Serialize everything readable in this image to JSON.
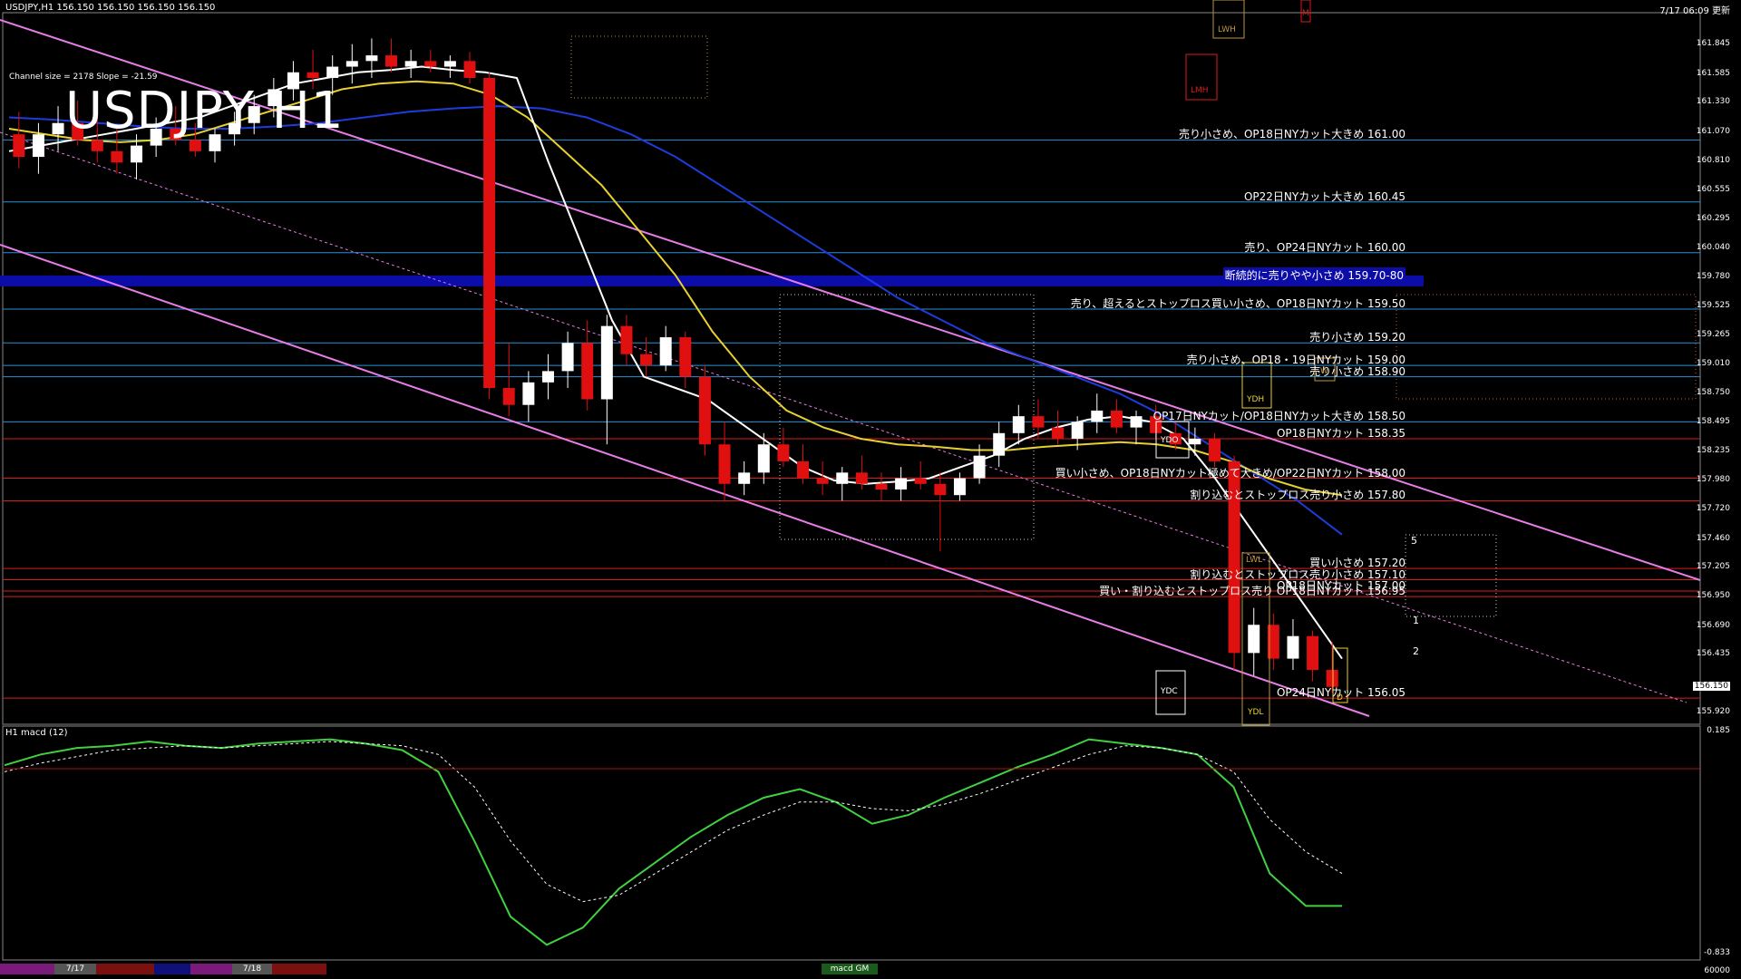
{
  "header": {
    "symbol_line": "USDJPY,H1 156.150 156.150 156.150 156.150",
    "datetime": "7/17 06:09 更新",
    "channel_info": "Channel size = 2178 Slope = -21.59",
    "big_title": "USDJPY H1"
  },
  "macd_panel": {
    "label": "H1 macd (12)",
    "axis_top": "0.185",
    "axis_bottom": "-0.833",
    "tab_label": "macd GM"
  },
  "bottom_axis": {
    "right_value": "60000",
    "dates": [
      "7/17",
      "7/18"
    ]
  },
  "box_labels": {
    "lwh": "LWH",
    "lmh": "LMH",
    "m": "M",
    "ydh": "YDH",
    "ydo": "YDO",
    "lwl": "LWL",
    "ydc": "YDC",
    "ydl": "YDL",
    "w": "W",
    "d": "D"
  },
  "wave_labels": [
    "1",
    "2",
    "5"
  ],
  "price_axis": [
    {
      "value": 161.845,
      "label": "161.845"
    },
    {
      "value": 161.585,
      "label": "161.585"
    },
    {
      "value": 161.33,
      "label": "161.330"
    },
    {
      "value": 161.07,
      "label": "161.070"
    },
    {
      "value": 160.81,
      "label": "160.810"
    },
    {
      "value": 160.555,
      "label": "160.555"
    },
    {
      "value": 160.295,
      "label": "160.295"
    },
    {
      "value": 160.04,
      "label": "160.040"
    },
    {
      "value": 159.78,
      "label": "159.780"
    },
    {
      "value": 159.525,
      "label": "159.525"
    },
    {
      "value": 159.265,
      "label": "159.265"
    },
    {
      "value": 159.01,
      "label": "159.010"
    },
    {
      "value": 158.75,
      "label": "158.750"
    },
    {
      "value": 158.495,
      "label": "158.495"
    },
    {
      "value": 158.235,
      "label": "158.235"
    },
    {
      "value": 157.98,
      "label": "157.980"
    },
    {
      "value": 157.72,
      "label": "157.720"
    },
    {
      "value": 157.46,
      "label": "157.460"
    },
    {
      "value": 157.205,
      "label": "157.205"
    },
    {
      "value": 156.95,
      "label": "156.950"
    },
    {
      "value": 156.69,
      "label": "156.690"
    },
    {
      "value": 156.435,
      "label": "156.435"
    },
    {
      "value": 156.15,
      "label": "156.150"
    },
    {
      "value": 155.92,
      "label": "155.920"
    }
  ],
  "chart_data": {
    "type": "line",
    "symbol": "USDJPY",
    "timeframe": "H1",
    "ylim": [
      155.85,
      162.0
    ],
    "last_price": 156.15,
    "order_levels": [
      {
        "price": 161.0,
        "text": "売り小さめ、OP18日NYカット大きめ 161.00",
        "color": "#2a8fd8",
        "highlight": false
      },
      {
        "price": 160.45,
        "text": "OP22日NYカット大きめ 160.45",
        "color": "#2a8fd8",
        "highlight": false
      },
      {
        "price": 160.0,
        "text": "売り、OP24日NYカット 160.00",
        "color": "#2a8fd8",
        "highlight": false
      },
      {
        "price": 159.75,
        "text": "断続的に売りやや小さめ 159.70-80",
        "color": "#0c0ca8",
        "highlight": true
      },
      {
        "price": 159.5,
        "text": "売り、超えるとストップロス買い小さめ、OP18日NYカット 159.50",
        "color": "#2a8fd8",
        "highlight": false
      },
      {
        "price": 159.2,
        "text": "売り小さめ 159.20",
        "color": "#2a8fd8",
        "highlight": false
      },
      {
        "price": 159.0,
        "text": "売り小さめ、OP18・19日NYカット 159.00",
        "color": "#2a8fd8",
        "highlight": false
      },
      {
        "price": 158.9,
        "text": "売り小さめ 158.90",
        "color": "#2a8fd8",
        "highlight": false
      },
      {
        "price": 158.5,
        "text": "OP17日NYカット/OP18日NYカット大きめ 158.50",
        "color": "#2a8fd8",
        "highlight": false
      },
      {
        "price": 158.35,
        "text": "OP18日NYカット 158.35",
        "color": "#d81c1c",
        "highlight": false
      },
      {
        "price": 158.0,
        "text": "買い小さめ、OP18日NYカット極めて大きめ/OP22日NYカット 158.00",
        "color": "#d81c1c",
        "highlight": false
      },
      {
        "price": 157.8,
        "text": "割り込むとストップロス売り小さめ 157.80",
        "color": "#d81c1c",
        "highlight": false
      },
      {
        "price": 157.2,
        "text": "買い小さめ 157.20",
        "color": "#d81c1c",
        "highlight": false
      },
      {
        "price": 157.1,
        "text": "割り込むとストップロス売り小さめ 157.10",
        "color": "#d81c1c",
        "highlight": false
      },
      {
        "price": 157.0,
        "text": "OP18日NYカット 157.00",
        "color": "#d81c1c",
        "highlight": false
      },
      {
        "price": 156.95,
        "text": "買い・割り込むとストップロス売り OP18日NYカット 156.95",
        "color": "#d81c1c",
        "highlight": false
      },
      {
        "price": 156.05,
        "text": "OP24日NYカット 156.05",
        "color": "#d81c1c",
        "highlight": false
      }
    ],
    "candles": [
      [
        161.05,
        161.25,
        160.75,
        160.85
      ],
      [
        160.85,
        161.15,
        160.7,
        161.05
      ],
      [
        161.05,
        161.3,
        160.9,
        161.15
      ],
      [
        161.15,
        161.35,
        160.95,
        161.0
      ],
      [
        161.0,
        161.2,
        160.8,
        160.9
      ],
      [
        160.9,
        161.1,
        160.7,
        160.8
      ],
      [
        160.8,
        161.05,
        160.65,
        160.95
      ],
      [
        160.95,
        161.2,
        160.85,
        161.1
      ],
      [
        161.1,
        161.3,
        160.95,
        161.0
      ],
      [
        161.0,
        161.15,
        160.85,
        160.9
      ],
      [
        160.9,
        161.1,
        160.8,
        161.05
      ],
      [
        161.05,
        161.25,
        160.95,
        161.15
      ],
      [
        161.15,
        161.4,
        161.05,
        161.3
      ],
      [
        161.3,
        161.55,
        161.2,
        161.45
      ],
      [
        161.45,
        161.7,
        161.35,
        161.6
      ],
      [
        161.6,
        161.8,
        161.45,
        161.55
      ],
      [
        161.55,
        161.75,
        161.4,
        161.65
      ],
      [
        161.65,
        161.85,
        161.5,
        161.7
      ],
      [
        161.7,
        161.9,
        161.55,
        161.75
      ],
      [
        161.75,
        161.9,
        161.6,
        161.65
      ],
      [
        161.65,
        161.8,
        161.55,
        161.7
      ],
      [
        161.7,
        161.8,
        161.6,
        161.65
      ],
      [
        161.65,
        161.75,
        161.55,
        161.7
      ],
      [
        161.7,
        161.78,
        161.5,
        161.55
      ],
      [
        161.55,
        161.6,
        158.7,
        158.8
      ],
      [
        158.8,
        159.2,
        158.55,
        158.65
      ],
      [
        158.65,
        158.95,
        158.5,
        158.85
      ],
      [
        158.85,
        159.1,
        158.7,
        158.95
      ],
      [
        158.95,
        159.3,
        158.8,
        159.2
      ],
      [
        159.2,
        159.4,
        158.6,
        158.7
      ],
      [
        158.7,
        159.45,
        158.3,
        159.35
      ],
      [
        159.35,
        159.45,
        159.0,
        159.1
      ],
      [
        159.1,
        159.25,
        158.9,
        159.0
      ],
      [
        159.0,
        159.35,
        158.95,
        159.25
      ],
      [
        159.25,
        159.3,
        158.8,
        158.9
      ],
      [
        158.9,
        159.0,
        158.2,
        158.3
      ],
      [
        158.3,
        158.5,
        157.8,
        157.95
      ],
      [
        157.95,
        158.15,
        157.85,
        158.05
      ],
      [
        158.05,
        158.4,
        157.95,
        158.3
      ],
      [
        158.3,
        158.45,
        158.1,
        158.15
      ],
      [
        158.15,
        158.3,
        157.95,
        158.0
      ],
      [
        158.0,
        158.15,
        157.85,
        157.95
      ],
      [
        157.95,
        158.1,
        157.8,
        158.05
      ],
      [
        158.05,
        158.2,
        157.9,
        157.95
      ],
      [
        157.95,
        158.05,
        157.8,
        157.9
      ],
      [
        157.9,
        158.1,
        157.8,
        158.0
      ],
      [
        158.0,
        158.15,
        157.9,
        157.95
      ],
      [
        157.95,
        158.05,
        157.35,
        157.85
      ],
      [
        157.85,
        158.05,
        157.8,
        158.0
      ],
      [
        158.0,
        158.3,
        157.95,
        158.2
      ],
      [
        158.2,
        158.5,
        158.1,
        158.4
      ],
      [
        158.4,
        158.65,
        158.3,
        158.55
      ],
      [
        158.55,
        158.7,
        158.35,
        158.45
      ],
      [
        158.45,
        158.6,
        158.3,
        158.35
      ],
      [
        158.35,
        158.55,
        158.25,
        158.5
      ],
      [
        158.5,
        158.75,
        158.4,
        158.6
      ],
      [
        158.6,
        158.7,
        158.4,
        158.45
      ],
      [
        158.45,
        158.6,
        158.3,
        158.55
      ],
      [
        158.55,
        158.65,
        158.35,
        158.4
      ],
      [
        158.4,
        158.5,
        158.25,
        158.3
      ],
      [
        158.3,
        158.45,
        158.2,
        158.35
      ],
      [
        158.35,
        158.4,
        158.1,
        158.15
      ],
      [
        158.15,
        158.2,
        156.3,
        156.45
      ],
      [
        156.45,
        156.85,
        156.25,
        156.7
      ],
      [
        156.7,
        156.8,
        156.3,
        156.4
      ],
      [
        156.4,
        156.75,
        156.3,
        156.6
      ],
      [
        156.6,
        156.65,
        156.2,
        156.3
      ],
      [
        156.3,
        156.55,
        156.1,
        156.15
      ]
    ],
    "ma_white": [
      160.9,
      160.95,
      161.0,
      161.05,
      161.1,
      161.15,
      161.2,
      161.3,
      161.4,
      161.5,
      161.55,
      161.6,
      161.62,
      161.65,
      161.62,
      161.6,
      161.55,
      160.8,
      160.1,
      159.4,
      158.9,
      158.8,
      158.7,
      158.5,
      158.3,
      158.1,
      157.98,
      157.95,
      157.97,
      158.0,
      158.1,
      158.2,
      158.35,
      158.45,
      158.52,
      158.55,
      158.5,
      158.35,
      158.0,
      157.6,
      157.2,
      156.8,
      156.4
    ],
    "ma_yellow": [
      161.1,
      161.05,
      161.0,
      160.98,
      161.0,
      161.05,
      161.15,
      161.25,
      161.35,
      161.45,
      161.5,
      161.52,
      161.5,
      161.4,
      161.2,
      160.9,
      160.6,
      160.2,
      159.8,
      159.3,
      158.9,
      158.6,
      158.45,
      158.35,
      158.3,
      158.28,
      158.25,
      158.25,
      158.28,
      158.3,
      158.32,
      158.3,
      158.25,
      158.15,
      158.0,
      157.9,
      157.85
    ],
    "ma_blue": [
      161.2,
      161.18,
      161.15,
      161.12,
      161.1,
      161.1,
      161.12,
      161.15,
      161.2,
      161.25,
      161.28,
      161.3,
      161.28,
      161.2,
      161.05,
      160.85,
      160.6,
      160.35,
      160.1,
      159.85,
      159.6,
      159.4,
      159.2,
      159.05,
      158.9,
      158.75,
      158.55,
      158.3,
      158.05,
      157.8,
      157.5
    ],
    "macd_main": [
      0.05,
      0.1,
      0.13,
      0.14,
      0.16,
      0.14,
      0.13,
      0.15,
      0.16,
      0.17,
      0.15,
      0.12,
      0.02,
      -0.3,
      -0.65,
      -0.78,
      -0.7,
      -0.52,
      -0.4,
      -0.28,
      -0.18,
      -0.1,
      -0.06,
      -0.12,
      -0.22,
      -0.18,
      -0.1,
      -0.03,
      0.04,
      0.1,
      0.17,
      0.15,
      0.13,
      0.1,
      -0.05,
      -0.45,
      -0.6,
      -0.6
    ],
    "macd_signal": [
      0.02,
      0.06,
      0.09,
      0.12,
      0.13,
      0.14,
      0.13,
      0.14,
      0.15,
      0.16,
      0.15,
      0.14,
      0.1,
      -0.05,
      -0.3,
      -0.5,
      -0.58,
      -0.55,
      -0.45,
      -0.35,
      -0.25,
      -0.18,
      -0.12,
      -0.12,
      -0.15,
      -0.16,
      -0.13,
      -0.08,
      -0.02,
      0.04,
      0.1,
      0.14,
      0.13,
      0.1,
      0.02,
      -0.2,
      -0.35,
      -0.45
    ],
    "macd_ylim": [
      -0.833,
      0.185
    ]
  }
}
